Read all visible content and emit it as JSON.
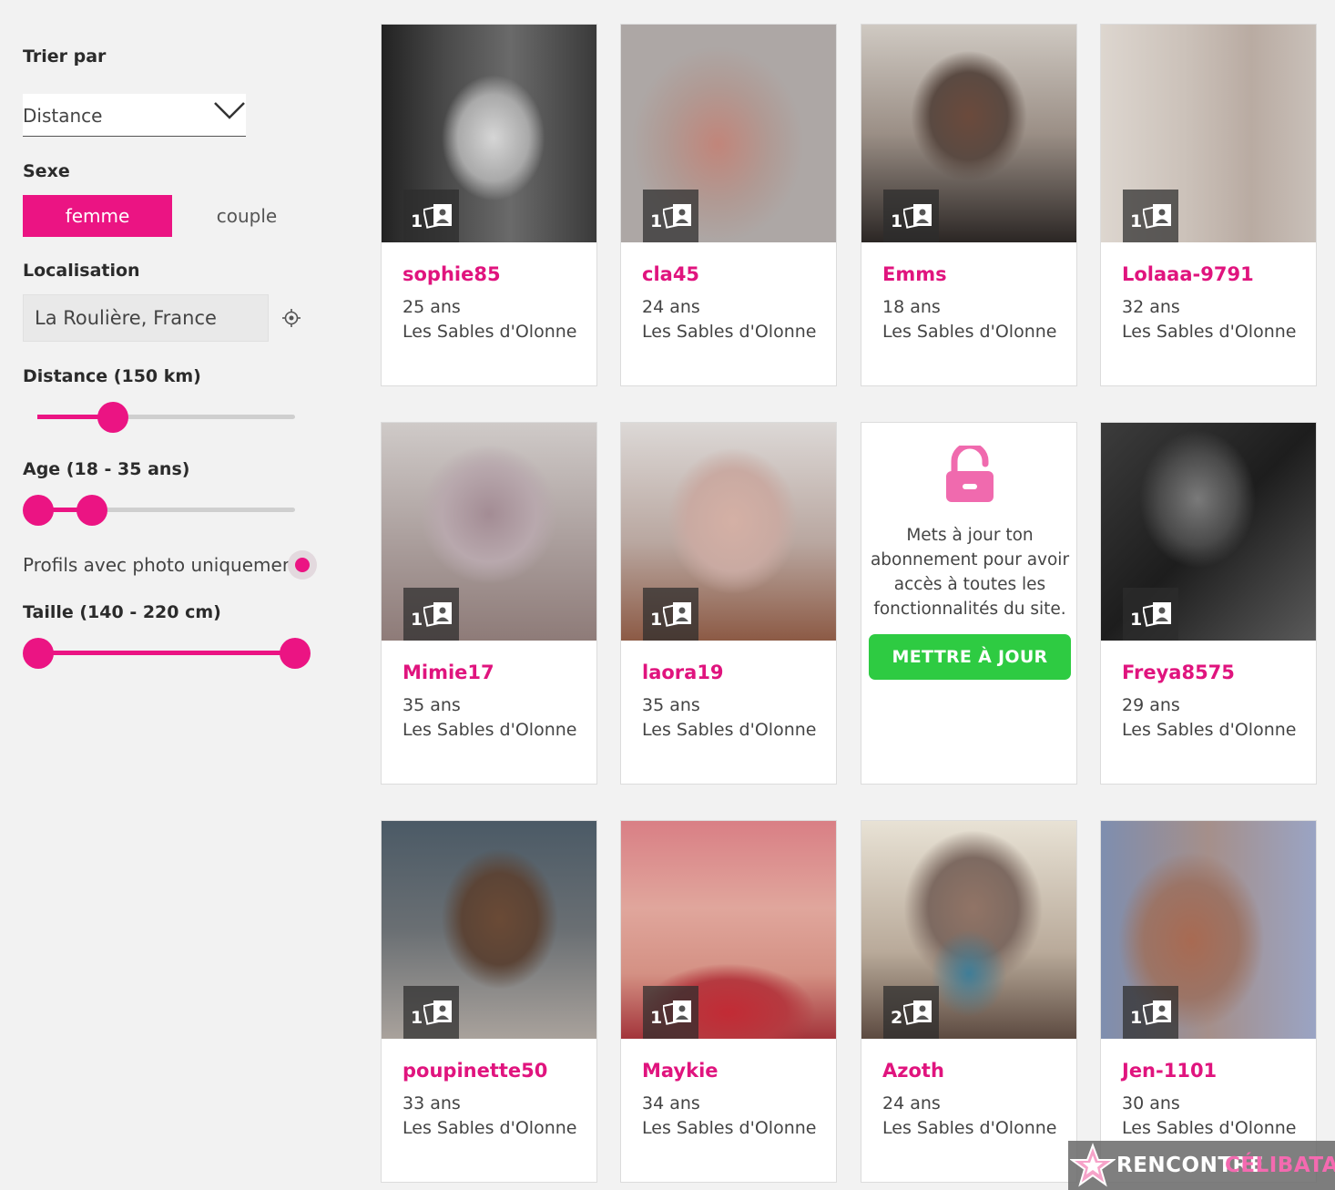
{
  "filters": {
    "sort_label": "Trier par",
    "sort_value": "Distance",
    "sex_label": "Sexe",
    "sex_options": [
      "femme",
      "couple"
    ],
    "sex_selected": "femme",
    "location_label": "Localisation",
    "location_value": "La Roulière, France",
    "distance_label": "Distance (150 km)",
    "distance_value_km": 150,
    "age_label": "Age (18 - 35 ans)",
    "age_range": [
      18,
      35
    ],
    "photo_only_label": "Profils avec photo uniquement",
    "photo_only_checked": true,
    "height_label": "Taille (140 - 220 cm)",
    "height_range": [
      140,
      220
    ]
  },
  "profiles": [
    {
      "name": "sophie85",
      "age": "25 ans",
      "city": "Les Sables d'Olonne",
      "photos": "1"
    },
    {
      "name": "cla45",
      "age": "24 ans",
      "city": "Les Sables d'Olonne",
      "photos": "1"
    },
    {
      "name": "Emms",
      "age": "18 ans",
      "city": "Les Sables d'Olonne",
      "photos": "1"
    },
    {
      "name": "Lolaaa-9791",
      "age": "32 ans",
      "city": "Les Sables d'Olonne",
      "photos": "1"
    },
    {
      "name": "Mimie17",
      "age": "35 ans",
      "city": "Les Sables d'Olonne",
      "photos": "1"
    },
    {
      "name": "laora19",
      "age": "35 ans",
      "city": "Les Sables d'Olonne",
      "photos": "1"
    },
    {
      "name": "Freya8575",
      "age": "29 ans",
      "city": "Les Sables d'Olonne",
      "photos": "1"
    },
    {
      "name": "poupinette50",
      "age": "33 ans",
      "city": "Les Sables d'Olonne",
      "photos": "1"
    },
    {
      "name": "Maykie",
      "age": "34 ans",
      "city": "Les Sables d'Olonne",
      "photos": "1"
    },
    {
      "name": "Azoth",
      "age": "24 ans",
      "city": "Les Sables d'Olonne",
      "photos": "2"
    },
    {
      "name": "Jen-1101",
      "age": "30 ans",
      "city": "Les Sables d'Olonne",
      "photos": "1"
    }
  ],
  "upgrade": {
    "message": "Mets à jour ton abonnement pour avoir accès à toutes les fonctionnalités du site.",
    "button": "METTRE À JOUR"
  },
  "brand": {
    "part1": "RENCONTRE",
    "part2": "CÉLIBATAIRE"
  },
  "icons": {
    "sort": "chevron-down-icon",
    "location": "crosshair-icon",
    "photo_count": "photo-stack-icon",
    "upgrade": "unlock-icon",
    "brand": "star-logo-icon"
  },
  "colors": {
    "accent": "#eb1483",
    "profile_name": "#e0147e",
    "cta": "#2ecb42"
  }
}
